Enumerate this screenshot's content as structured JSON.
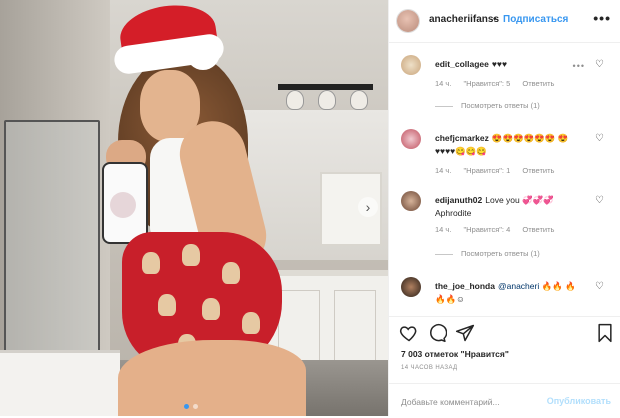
{
  "post": {
    "carousel": {
      "slide_count": 2,
      "current_slide": 1
    }
  },
  "header": {
    "username": "anacheriifanss",
    "separator": "•",
    "follow_label": "Подписаться",
    "more_label": "•••"
  },
  "comments": [
    {
      "username": "edit_collagee",
      "text": "♥♥♥",
      "age": "14 ч.",
      "likes": "\"Нравится\": 5",
      "reply": "Ответить",
      "replies": "Посмотреть ответы (1)"
    },
    {
      "username": "chefjcmarkez",
      "text": "😍😍😍😍😍😍 😍♥♥♥♥😋😋😋",
      "age": "14 ч.",
      "likes": "\"Нравится\": 1",
      "reply": "Ответить",
      "replies": ""
    },
    {
      "username": "edijanuth02",
      "text": "Love you 💞💞💞 Aphrodite",
      "age": "14 ч.",
      "likes": "\"Нравится\": 4",
      "reply": "Ответить",
      "replies": "Посмотреть ответы (1)"
    },
    {
      "username": "the_joe_honda",
      "mention": "@anacheri",
      "text": " 🔥🔥 🔥🔥🔥☺",
      "age": "",
      "likes": "",
      "reply": "",
      "replies": ""
    }
  ],
  "actions": {
    "icons": [
      "heart-icon",
      "comment-icon",
      "share-icon",
      "bookmark-icon"
    ],
    "likes_text": "7 003 отметок \"Нравится\"",
    "time_text": "14 ЧАСОВ НАЗАД",
    "comment_placeholder": "Добавьте комментарий...",
    "post_label": "Опубликовать"
  },
  "colors": {
    "accent": "#3897f0",
    "post_disabled": "#b2dffc",
    "muted": "#8e8e8e"
  }
}
